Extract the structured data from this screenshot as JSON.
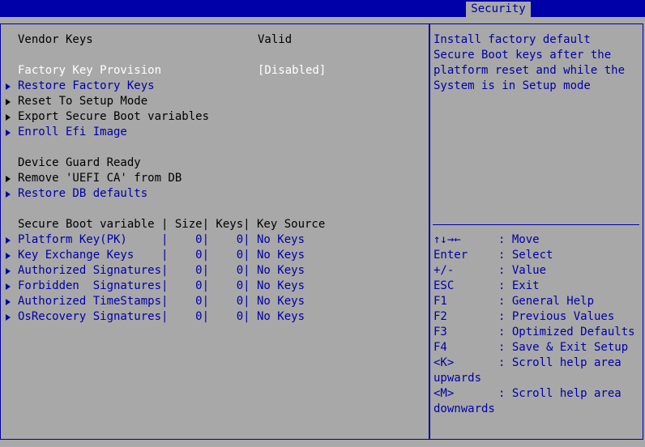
{
  "header": {
    "tab": "Security"
  },
  "main": {
    "vendor_keys_label": "Vendor Keys",
    "vendor_keys_value": "Valid",
    "factory_key_label": "Factory Key Provision",
    "factory_key_value": "[Disabled]",
    "restore_factory_keys": "Restore Factory Keys",
    "reset_setup_mode": "Reset To Setup Mode",
    "export_vars": "Export Secure Boot variables",
    "enroll_efi": "Enroll Efi Image",
    "device_guard": "Device Guard Ready",
    "remove_uefi_ca": "Remove 'UEFI CA' from DB",
    "restore_db": "Restore DB defaults",
    "table_header": "Secure Boot variable | Size| Keys| Key Source",
    "rows": [
      "Platform Key(PK)     |    0|    0| No Keys",
      "Key Exchange Keys    |    0|    0| No Keys",
      "Authorized Signatures|    0|    0| No Keys",
      "Forbidden  Signatures|    0|    0| No Keys",
      "Authorized TimeStamps|    0|    0| No Keys",
      "OsRecovery Signatures|    0|    0| No Keys"
    ]
  },
  "help": {
    "description": "Install factory default Secure Boot keys after the platform reset and while the System is in Setup mode",
    "keys": [
      {
        "key": "↑↓→←",
        "action": ": Move"
      },
      {
        "key": "Enter",
        "action": ": Select"
      },
      {
        "key": "+/-",
        "action": ": Value"
      },
      {
        "key": "ESC",
        "action": ": Exit"
      },
      {
        "key": "F1",
        "action": ": General Help"
      },
      {
        "key": "F2",
        "action": ": Previous Values"
      },
      {
        "key": "F3",
        "action": ": Optimized Defaults"
      },
      {
        "key": "F4",
        "action": ": Save & Exit Setup"
      },
      {
        "key": "<K>",
        "action": ": Scroll help area"
      },
      {
        "key": "upwards",
        "action": ""
      },
      {
        "key": "<M>",
        "action": ": Scroll help area"
      },
      {
        "key": "downwards",
        "action": ""
      }
    ]
  }
}
